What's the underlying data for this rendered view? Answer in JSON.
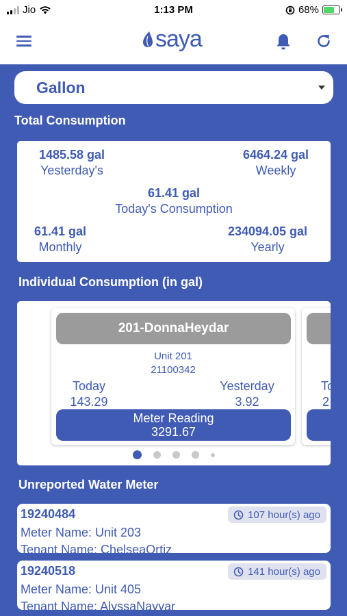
{
  "status_bar": {
    "carrier": "Jio",
    "time": "1:13 PM",
    "battery": "68%",
    "battery_level": 0.68
  },
  "header": {
    "logo_text": "saya",
    "icons": [
      "menu-icon",
      "bell-icon",
      "refresh-icon"
    ]
  },
  "unit_select": {
    "value": "Gallon"
  },
  "total_consumption": {
    "title": "Total Consumption",
    "yesterday": {
      "value": "1485.58 gal",
      "label": "Yesterday's"
    },
    "weekly": {
      "value": "6464.24 gal",
      "label": "Weekly"
    },
    "today": {
      "value": "61.41 gal",
      "label": "Today's Consumption"
    },
    "monthly": {
      "value": "61.41 gal",
      "label": "Monthly"
    },
    "yearly": {
      "value": "234094.05 gal",
      "label": "Yearly"
    }
  },
  "individual": {
    "title": "Individual Consumption (in gal)",
    "cards": [
      {
        "name": "201-DonnaHeydar",
        "unit": "Unit 201",
        "meter_id": "21100342",
        "today_label": "Today",
        "today_value": "143.29",
        "yesterday_label": "Yesterday",
        "yesterday_value": "3.92",
        "reading_label": "Meter Reading",
        "reading_value": "3291.67"
      }
    ],
    "peek": {
      "today_label": "To",
      "today_value": "2"
    },
    "pagination": {
      "total": 5,
      "active": 0
    }
  },
  "unreported": {
    "title": "Unreported Water Meter",
    "items": [
      {
        "meter_id": "19240484",
        "ago": "107 hour(s) ago",
        "meter_name": "Meter Name: Unit 203",
        "tenant": "Tenant Name: ChelseaOrtiz"
      },
      {
        "meter_id": "19240518",
        "ago": "141 hour(s) ago",
        "meter_name": "Meter Name: Unit 405",
        "tenant": "Tenant Name: AlyssaNayyar"
      }
    ]
  },
  "colors": {
    "brand": "#3f5bb3",
    "card_header": "#9b9b9b",
    "badge_bg": "#dfe2ee"
  }
}
